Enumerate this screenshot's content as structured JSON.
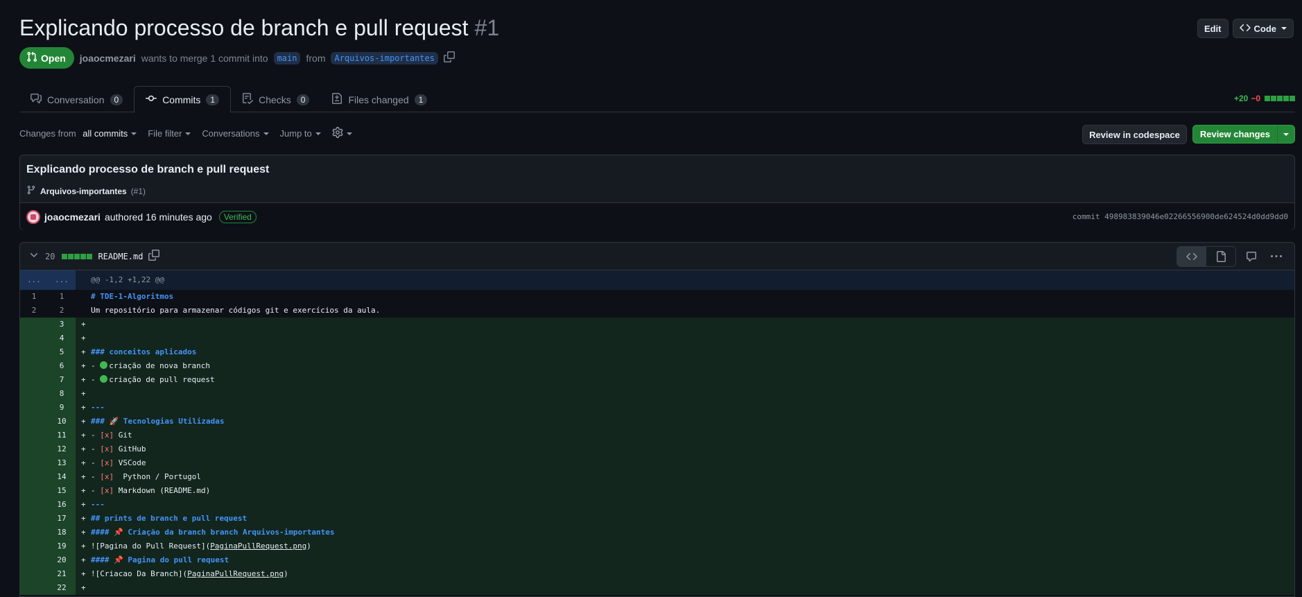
{
  "pr": {
    "title": "Explicando processo de branch e pull request",
    "number": "#1",
    "state": "Open",
    "author": "joaocmezari",
    "merge_text": "wants to merge 1 commit into",
    "base_branch": "main",
    "from_text": "from",
    "head_branch": "Arquivos-importantes"
  },
  "header_actions": {
    "edit": "Edit",
    "code": "Code"
  },
  "tabs": [
    {
      "label": "Conversation",
      "count": "0",
      "icon": "comment-discussion-icon"
    },
    {
      "label": "Commits",
      "count": "1",
      "icon": "git-commit-icon"
    },
    {
      "label": "Checks",
      "count": "0",
      "icon": "checklist-icon"
    },
    {
      "label": "Files changed",
      "count": "1",
      "icon": "file-diff-icon"
    }
  ],
  "diffstat": {
    "additions": "+20",
    "deletions": "−0"
  },
  "toolbar": {
    "changes_prefix": "Changes from",
    "changes_value": "all commits",
    "file_filter": "File filter",
    "conversations": "Conversations",
    "jump_to": "Jump to",
    "review_codespace": "Review in codespace",
    "review_changes": "Review changes"
  },
  "commit": {
    "title": "Explicando processo de branch e pull request",
    "branch": "Arquivos-importantes",
    "pr_ref": "(#1)",
    "author": "joaocmezari",
    "authored": "authored 16 minutes ago",
    "verified": "Verified",
    "sha_text": "commit 498983839046e02266556900de624524d0dd9dd0"
  },
  "file": {
    "changes": "20",
    "name": "README.md",
    "hunk_left": "...",
    "hunk_right": "...",
    "hunk_header": "@@ -1,2 +1,22 @@"
  },
  "diff_lines": [
    {
      "old": "1",
      "new": "1",
      "type": "ctx",
      "text": "# TDE-1-Algoritmos"
    },
    {
      "old": "2",
      "new": "2",
      "type": "ctx",
      "text": "Um repositório para armazenar códigos git e exercícios da aula."
    },
    {
      "old": "",
      "new": "3",
      "type": "ins",
      "text": ""
    },
    {
      "old": "",
      "new": "4",
      "type": "ins",
      "text": ""
    },
    {
      "old": "",
      "new": "5",
      "type": "ins",
      "text": "### conceitos aplicados"
    },
    {
      "old": "",
      "new": "6",
      "type": "ins",
      "text": "- criação de nova branch"
    },
    {
      "old": "",
      "new": "7",
      "type": "ins",
      "text": "- criação de pull request"
    },
    {
      "old": "",
      "new": "8",
      "type": "ins",
      "text": ""
    },
    {
      "old": "",
      "new": "9",
      "type": "ins",
      "text": "---"
    },
    {
      "old": "",
      "new": "10",
      "type": "ins",
      "text": "### 🚀 Tecnologias Utilizadas"
    },
    {
      "old": "",
      "new": "11",
      "type": "ins",
      "text": "- [x] Git"
    },
    {
      "old": "",
      "new": "12",
      "type": "ins",
      "text": "- [x] GitHub"
    },
    {
      "old": "",
      "new": "13",
      "type": "ins",
      "text": "- [x] VSCode"
    },
    {
      "old": "",
      "new": "14",
      "type": "ins",
      "text": "- [x]  Python / Portugol"
    },
    {
      "old": "",
      "new": "15",
      "type": "ins",
      "text": "- [x] Markdown (README.md)"
    },
    {
      "old": "",
      "new": "16",
      "type": "ins",
      "text": "---"
    },
    {
      "old": "",
      "new": "17",
      "type": "ins",
      "text": "## prints de branch e pull request"
    },
    {
      "old": "",
      "new": "18",
      "type": "ins",
      "text": "#### 📌 Criação da branch branch Arquivos-importantes"
    },
    {
      "old": "",
      "new": "19",
      "type": "ins",
      "text": "![Pagina do Pull Request](PaginaPullRequest.png)"
    },
    {
      "old": "",
      "new": "20",
      "type": "ins",
      "text": "#### 📌 Pagina do pull request"
    },
    {
      "old": "",
      "new": "21",
      "type": "ins",
      "text": "![Criacao Da Branch](PaginaPullRequest.png)"
    },
    {
      "old": "",
      "new": "22",
      "type": "ins",
      "text": ""
    }
  ],
  "colors": {
    "open_green": "#238636",
    "addition_bg": "#12261e",
    "heading_blue": "#4493f8",
    "checkbox_red": "#ff7b72"
  }
}
